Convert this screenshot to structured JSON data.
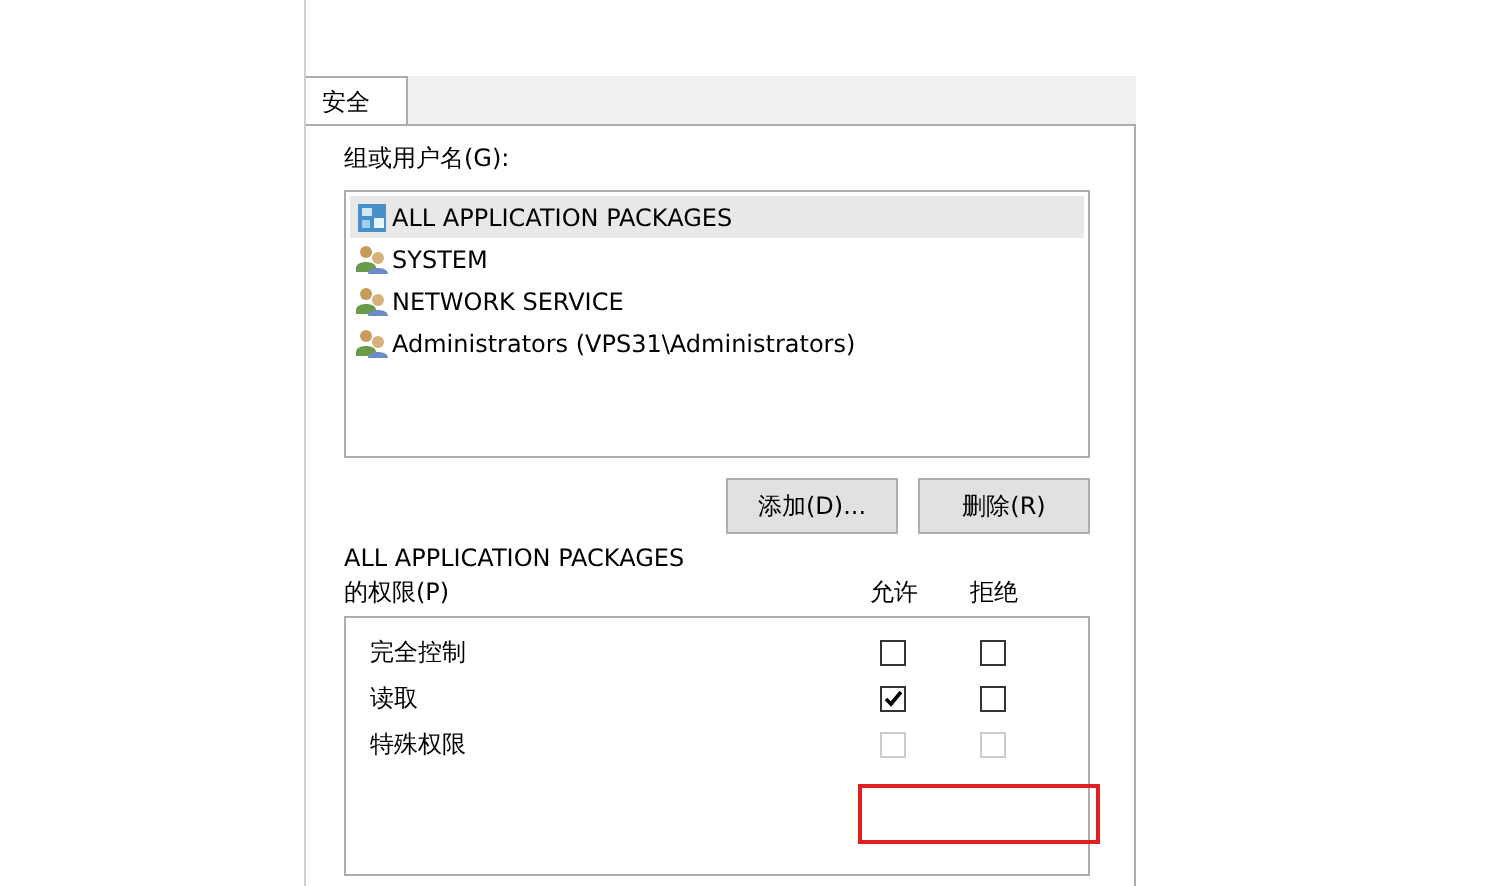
{
  "tabs": [
    {
      "label": "安全",
      "selected": true
    }
  ],
  "group_label": "组或用户名(G):",
  "users": [
    {
      "name": "ALL APPLICATION PACKAGES",
      "kind": "package",
      "selected": true
    },
    {
      "name": "SYSTEM",
      "kind": "group",
      "selected": false
    },
    {
      "name": "NETWORK SERVICE",
      "kind": "group",
      "selected": false
    },
    {
      "name": "Administrators (VPS31\\Administrators)",
      "kind": "group",
      "selected": false
    }
  ],
  "buttons": [
    "添加(D)...",
    "删除(R)"
  ],
  "permissions": {
    "title_lines": [
      "ALL APPLICATION PACKAGES",
      "的权限(P)"
    ],
    "columns": [
      "允许",
      "拒绝"
    ],
    "rows": [
      {
        "name": "完全控制",
        "allow": {
          "checked": false,
          "disabled": false
        },
        "deny": {
          "checked": false,
          "disabled": false
        }
      },
      {
        "name": "读取",
        "allow": {
          "checked": true,
          "disabled": false
        },
        "deny": {
          "checked": false,
          "disabled": false
        }
      },
      {
        "name": "特殊权限",
        "allow": {
          "checked": false,
          "disabled": true
        },
        "deny": {
          "checked": false,
          "disabled": true
        }
      }
    ]
  }
}
